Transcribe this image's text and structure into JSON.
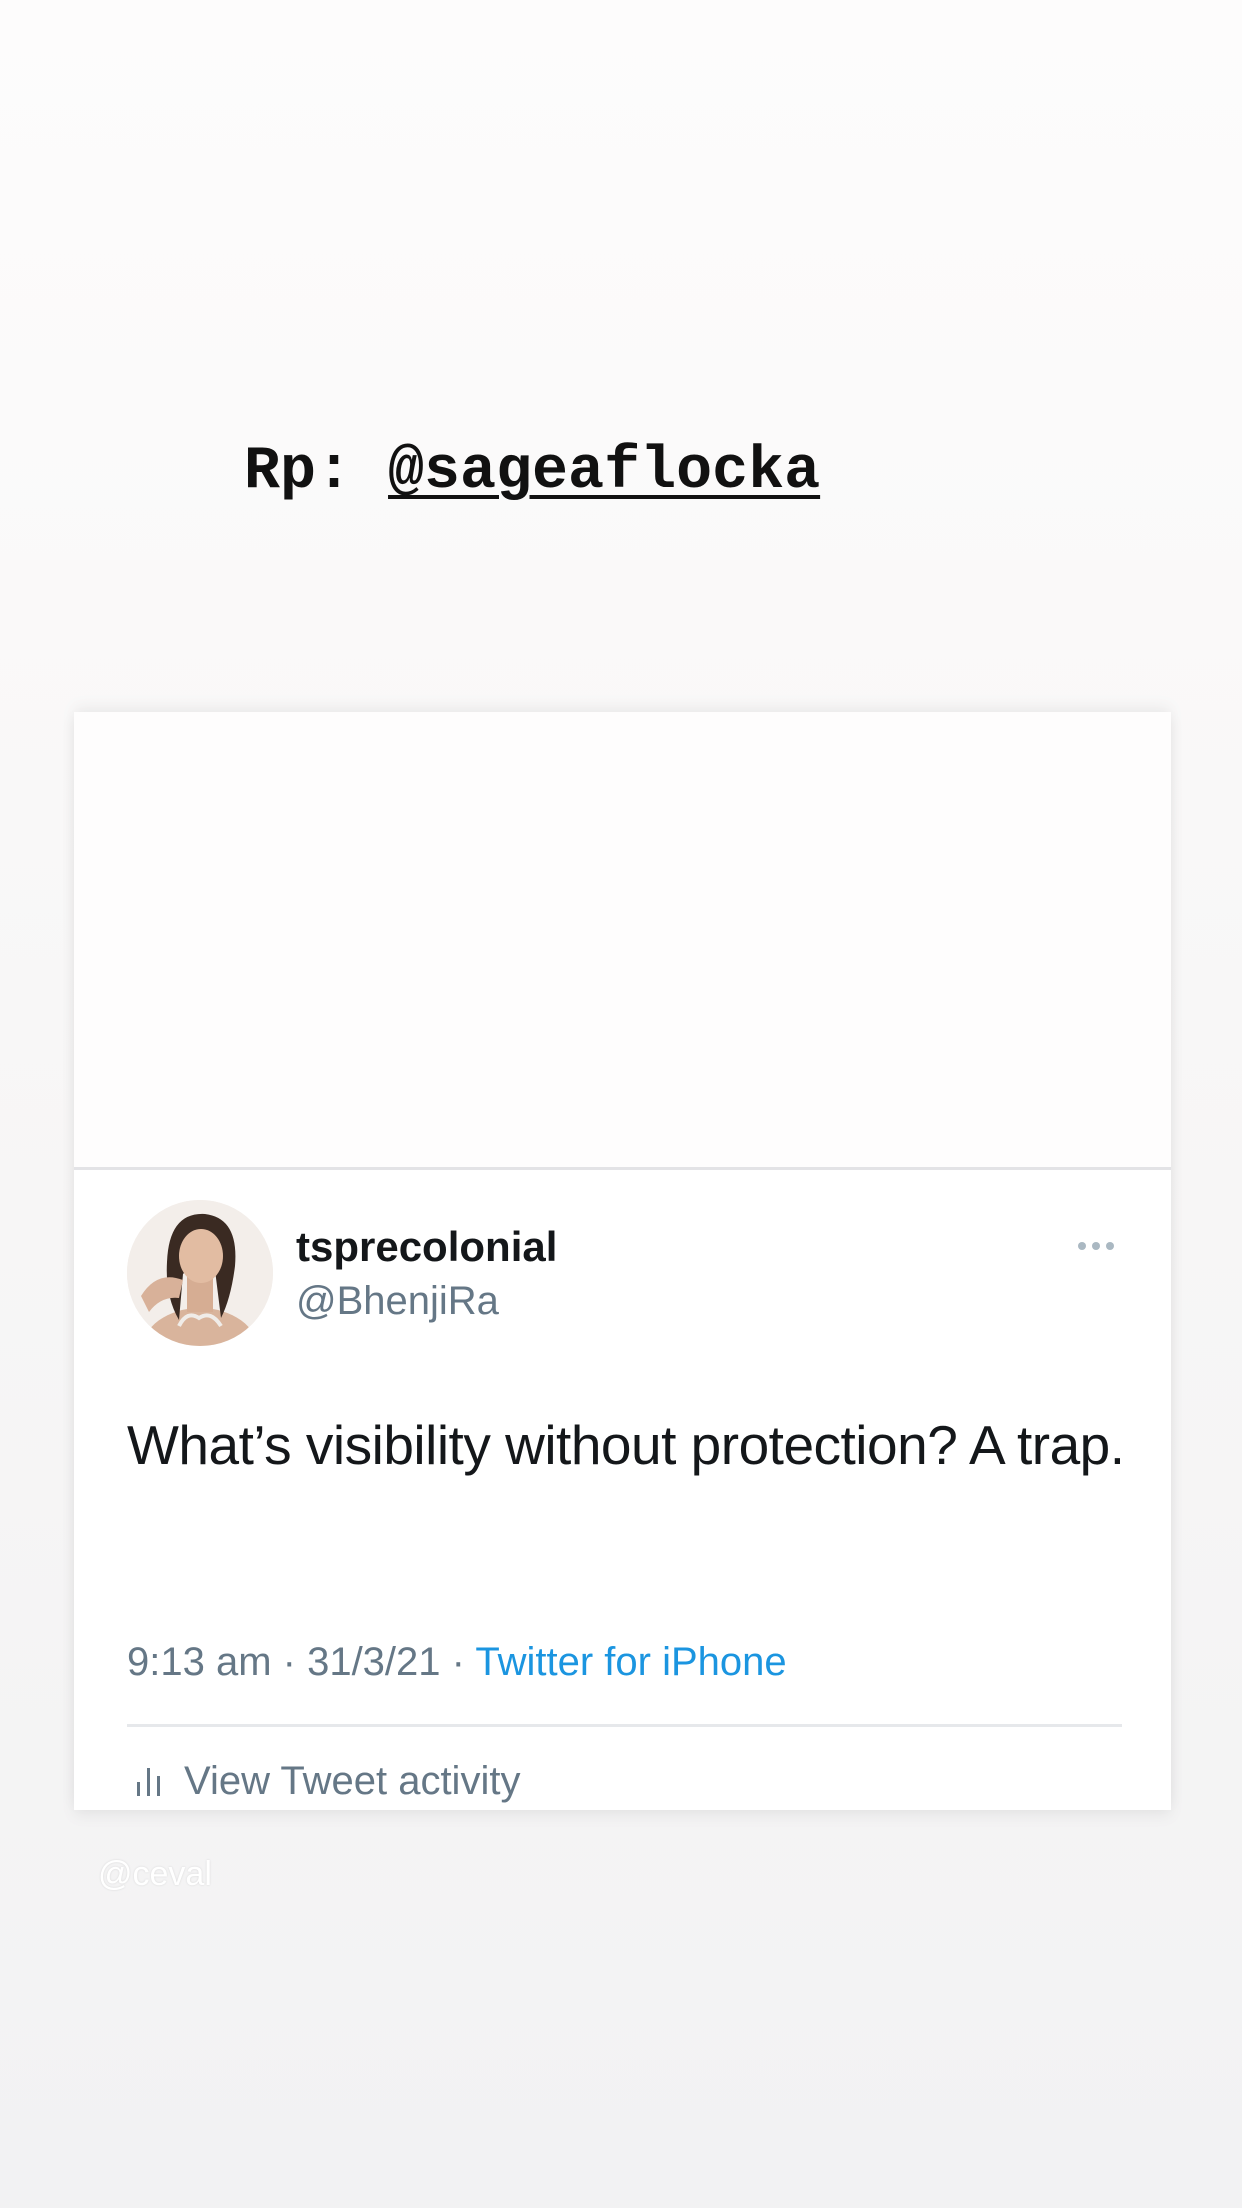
{
  "story": {
    "repost_prefix": "Rp: ",
    "repost_handle": "@sageaflocka",
    "watermark": "@ceval"
  },
  "tweet": {
    "display_name": "tsprecolonial",
    "username": "@BhenjiRa",
    "text": "What’s visibility without protection? A trap.",
    "time": "9:13 am",
    "separator": " · ",
    "date": "31/3/21",
    "source": "Twitter for iPhone",
    "activity_label": "View Tweet activity",
    "more_icon": "more-horizontal-icon",
    "activity_icon": "bar-chart-icon"
  },
  "colors": {
    "link_blue": "#1b95e0",
    "secondary_gray": "#657786",
    "primary_text": "#14171a"
  }
}
